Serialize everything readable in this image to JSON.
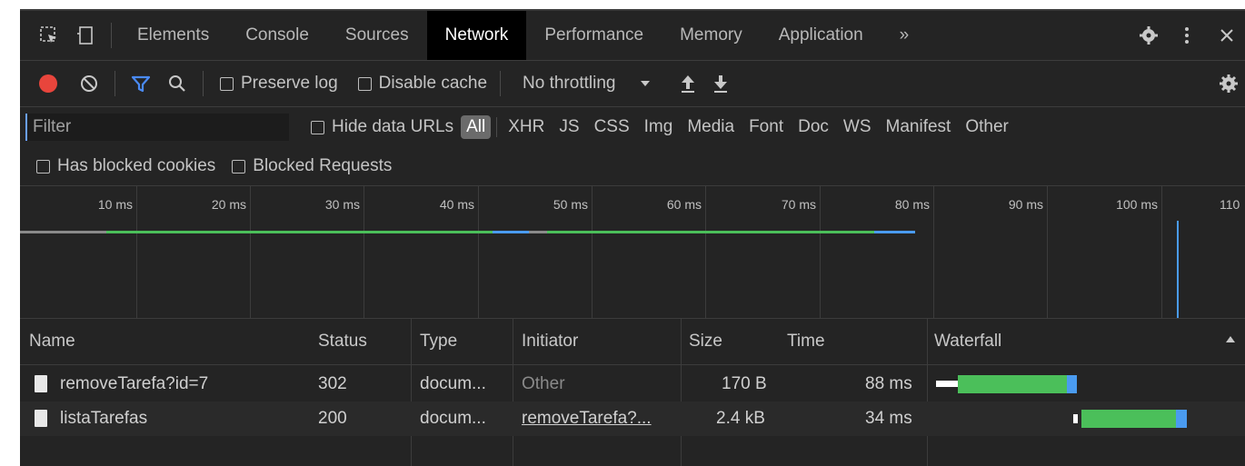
{
  "tabs": [
    {
      "label": "Elements",
      "active": false
    },
    {
      "label": "Console",
      "active": false
    },
    {
      "label": "Sources",
      "active": false
    },
    {
      "label": "Network",
      "active": true
    },
    {
      "label": "Performance",
      "active": false
    },
    {
      "label": "Memory",
      "active": false
    },
    {
      "label": "Application",
      "active": false
    }
  ],
  "tabbar": {
    "more_label": "»"
  },
  "toolbar": {
    "preserve_log": "Preserve log",
    "disable_cache": "Disable cache",
    "throttling": "No throttling"
  },
  "filterbar": {
    "placeholder": "Filter",
    "hide_data_urls": "Hide data URLs",
    "types": [
      "All",
      "XHR",
      "JS",
      "CSS",
      "Img",
      "Media",
      "Font",
      "Doc",
      "WS",
      "Manifest",
      "Other"
    ],
    "active_type": "All"
  },
  "cookiebar": {
    "blocked_cookies": "Has blocked cookies",
    "blocked_requests": "Blocked Requests"
  },
  "timeline": {
    "ticks": [
      "10 ms",
      "20 ms",
      "30 ms",
      "40 ms",
      "50 ms",
      "60 ms",
      "70 ms",
      "80 ms",
      "90 ms",
      "100 ms",
      "110"
    ]
  },
  "table": {
    "columns": [
      "Name",
      "Status",
      "Type",
      "Initiator",
      "Size",
      "Time",
      "Waterfall"
    ],
    "rows": [
      {
        "name": "removeTarefa?id=7",
        "status": "302",
        "type": "docum...",
        "initiator": "Other",
        "initiator_is_link": false,
        "size": "170 B",
        "time": "88 ms"
      },
      {
        "name": "listaTarefas",
        "status": "200",
        "type": "docum...",
        "initiator": "removeTarefa?...",
        "initiator_is_link": true,
        "size": "2.4 kB",
        "time": "34 ms"
      }
    ]
  },
  "colors": {
    "record": "#e8453c",
    "filter_icon": "#4a8af4",
    "waterfall_green": "#4bbf5a",
    "waterfall_blue": "#4a9bf0"
  }
}
